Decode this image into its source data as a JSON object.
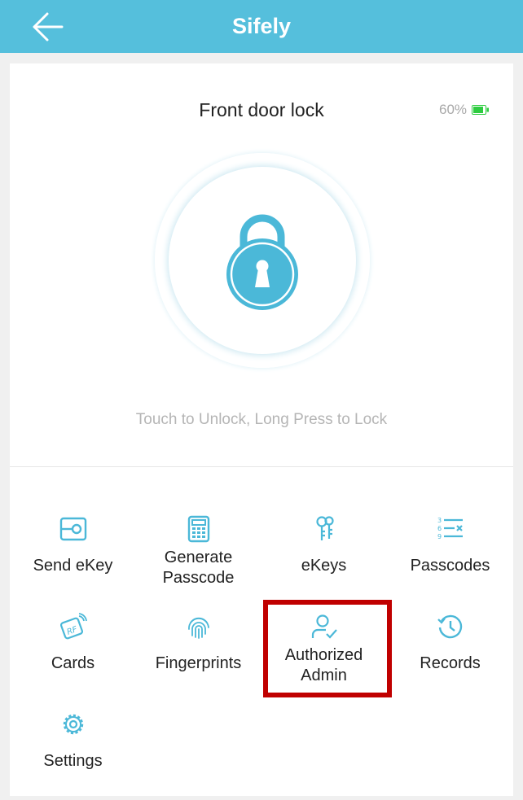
{
  "header": {
    "title": "Sifely",
    "back_icon": "arrow-left-icon",
    "background_color": "#55bfdc"
  },
  "lock": {
    "name": "Front door lock",
    "battery_text": "60%",
    "battery_level_percent": 60,
    "battery_color": "#2ecc40",
    "hint": "Touch to Unlock, Long Press to Lock",
    "lock_icon": "padlock-icon"
  },
  "menu": {
    "items": [
      {
        "label": "Send eKey",
        "icon": "send-ekey-icon"
      },
      {
        "label_line1": "Generate",
        "label_line2": "Passcode",
        "icon": "calculator-icon"
      },
      {
        "label": "eKeys",
        "icon": "keys-icon"
      },
      {
        "label": "Passcodes",
        "icon": "passcode-list-icon"
      },
      {
        "label": "Cards",
        "icon": "rf-card-icon"
      },
      {
        "label": "Fingerprints",
        "icon": "fingerprint-icon"
      },
      {
        "label_line1": "Authorized",
        "label_line2": "Admin",
        "icon": "user-check-icon"
      },
      {
        "label": "Records",
        "icon": "history-icon"
      },
      {
        "label": "Settings",
        "icon": "gear-icon"
      }
    ],
    "icon_color": "#4bb8d8",
    "highlight_color": "#c00000"
  }
}
